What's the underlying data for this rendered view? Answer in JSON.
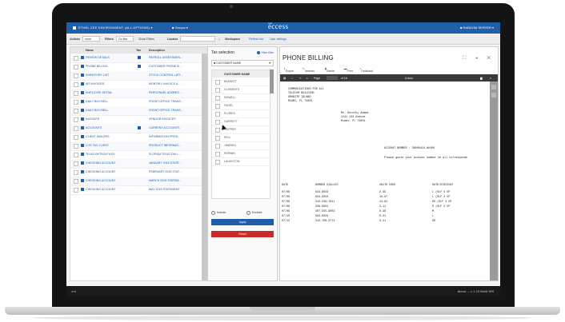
{
  "topbar": {
    "environment": "ETHEL ZEE ENVIRONMENT (ALL OPTIONS)",
    "group": "Groups",
    "app_prefix": "xcd",
    "app_name": "ëccess",
    "user": "RANDOM SERVER"
  },
  "actionbar": {
    "actions_label": "Actions",
    "actions_value": "none",
    "filters_label": "Filters",
    "filter_value": "Go Bar",
    "show_filters": "Show Filters",
    "locator_label": "Locator",
    "workspace_label": "Workspace",
    "refresh": "Refresh list",
    "user_settings": "User settings"
  },
  "grid": {
    "columns": [
      "Name",
      "Tax",
      "Description"
    ],
    "rows": [
      {
        "name": "REVIEW DETAILS",
        "desc": "PAYROLL ASSESSMEN..."
      },
      {
        "name": "PHONE BILLING",
        "desc": "CUSTOMER PHONE B..."
      },
      {
        "name": "INVENTORY LIST",
        "desc": "STOCK CONTROL LIST..."
      },
      {
        "name": "AR INVOICES",
        "desc": "MONTHLY INVOICE A..."
      },
      {
        "name": "EMPLOYEE DETAIL",
        "desc": "PERSONNEL ADDRES..."
      },
      {
        "name": "DAILY BUY/SELL",
        "desc": "FRONT OFFICE TRANS..."
      },
      {
        "name": "DAILY BUY/SELL",
        "desc": "FRONT OFFICE TRANS..."
      },
      {
        "name": "INVOICES",
        "desc": "VENDOR INVOICES"
      },
      {
        "name": "ACCOUNTS",
        "desc": "CURRENT ACCOUNTS"
      },
      {
        "name": "CLIENT MAILERS",
        "desc": "INFORMATION PROS..."
      },
      {
        "name": "CCE TAX CLIENT",
        "desc": "PRODUCT INFORMAT..."
      },
      {
        "name": "TELECONTROLFILES",
        "desc": "FLORIDA TELECOM L..."
      },
      {
        "name": "CHECKING ACCOUNT",
        "desc": "JANUARY 2015 STATE..."
      },
      {
        "name": "CHECKING ACCOUNT",
        "desc": "FEBRUARY 2015 STAT..."
      },
      {
        "name": "CHECKING ACCOUNT",
        "desc": "MARCH 2015 STATEM..."
      },
      {
        "name": "CHECKING ACCOUNT",
        "desc": "MAY 2015 STATEMENT"
      }
    ],
    "tax_flag_rows": [
      0,
      1,
      8
    ]
  },
  "tax": {
    "title": "Tax selection",
    "filter_label": "Filter filter",
    "dropdown_value": "CUSTOMER NAME",
    "list_header": "CUSTOMER NAME",
    "items": [
      "BASSETT",
      "CLEMENTS",
      "DOWELL",
      "FAGEL",
      "FLORES",
      "GARRETT",
      "HOPPER",
      "KELL",
      "JIMENEZ",
      "KERWIN",
      "LAUGHTON"
    ],
    "include": "Include",
    "exclude": "Exclude",
    "apply": "Apply",
    "reset": "Reset"
  },
  "viewer": {
    "title": "PHONE BILLING",
    "tools": [
      "Export",
      "Indexes",
      "Delete",
      "Print",
      "Databank"
    ],
    "pdf_page": "Page",
    "pdf_of": "of 16",
    "pdf_zoom": "A  Auto",
    "header_lines": [
      "COMMUNICATIONS FOR ALL",
      "TELECOM BUILDING",
      "GRANITE ISLAND",
      "MIAMI, FL 74801"
    ],
    "address_lines": [
      "Ms. Dorothy Adams",
      "1241 133 Avenue",
      "Miami, FL 74801"
    ],
    "account_line": "ACCOUNT NUMBER : 38000416-A0400",
    "quote_line": "Please quote your account number on all corresponde",
    "table_header": [
      "DATE",
      "NUMBER DIALLED",
      "UNITS USED",
      "RATE/DISCOUNT"
    ],
    "table_rows": [
      [
        "07/06",
        "834-8034",
        "2.99",
        "L   (SLF 4 UP"
      ],
      [
        "07/06",
        "834-8034",
        "10.97",
        "L   (SLF 4 UP"
      ],
      [
        "07/06",
        "312-539-7811",
        "11.94",
        "DS  (SLF 4 UP"
      ],
      [
        "07/08",
        "839-8901",
        "3.11",
        "D   (SLF 4 UP"
      ],
      [
        "07/09",
        "407-555-9002",
        "0.38",
        "M"
      ],
      [
        "07/10",
        "834-8034",
        "6.21",
        "L"
      ],
      [
        "07/12",
        "312-766-3772",
        "3.11",
        "DR"
      ]
    ]
  },
  "status": {
    "brand": "xcd",
    "info": "About  —  v 1.19 Build 999"
  }
}
